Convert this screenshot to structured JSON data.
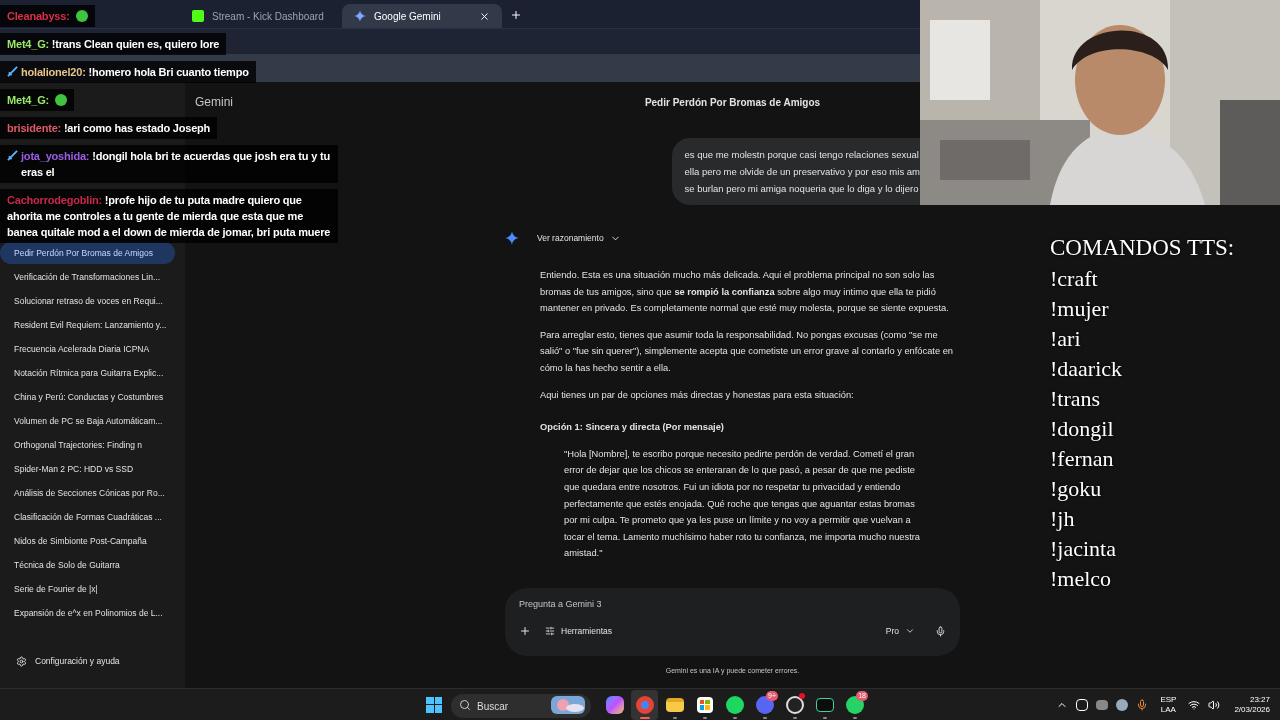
{
  "browser": {
    "tabs": [
      {
        "title": "Stream - Kick Dashboard",
        "selected": false
      },
      {
        "title": "Google Gemini",
        "selected": true
      }
    ]
  },
  "chat_overlay": {
    "messages": [
      {
        "user": "Cleanabyss:",
        "color": "#d9304a",
        "badge": false,
        "emote": true
      },
      {
        "user": "Met4_G:",
        "color": "#9be86a",
        "badge": false,
        "emote": false,
        "text": "!trans Clean quien es, quiero lore"
      },
      {
        "user": "holalionel20:",
        "color": "#e8c48a",
        "badge": true,
        "emote": false,
        "text": "!homero hola Bri cuanto tiempo"
      },
      {
        "user": "Met4_G:",
        "color": "#9be86a",
        "badge": false,
        "emote": true
      },
      {
        "user": "brisidente:",
        "color": "#e05a6a",
        "badge": false,
        "emote": false,
        "text": "!ari como has estado Joseph"
      },
      {
        "user": "jota_yoshida:",
        "color": "#9b5de5",
        "badge": true,
        "emote": false,
        "text": "!dongil hola bri te acuerdas que josh era tu y tu eras el"
      },
      {
        "user": "Cachorrodegoblin:",
        "color": "#c8284a",
        "badge": false,
        "emote": false,
        "text": "!profe hijo de tu puta madre quiero que ahorita me controles a tu gente de mierda que esta que me banea quitale mod a el down de mierda de jomar, bri puta muere"
      }
    ]
  },
  "gemini": {
    "product": "Gemini",
    "title": "Pedir Perdón Por Bromas de Amigos",
    "sidebar": {
      "items": [
        {
          "label": "Pedir Perdón Por Bromas de Amigos",
          "selected": true
        },
        {
          "label": "Verificación de Transformaciones Lin...",
          "selected": false
        },
        {
          "label": "Solucionar retraso de voces en Requi...",
          "selected": false
        },
        {
          "label": "Resident Evil Requiem: Lanzamiento y...",
          "selected": false
        },
        {
          "label": "Frecuencia Acelerada Diaria ICPNA",
          "selected": false
        },
        {
          "label": "Notación Rítmica para Guitarra Explic...",
          "selected": false
        },
        {
          "label": "China y Perú: Conductas y Costumbres",
          "selected": false
        },
        {
          "label": "Volumen de PC se Baja Automáticam...",
          "selected": false
        },
        {
          "label": "Orthogonal Trajectories: Finding n",
          "selected": false
        },
        {
          "label": "Spider-Man 2 PC: HDD vs SSD",
          "selected": false
        },
        {
          "label": "Análisis de Secciones Cónicas por Ro...",
          "selected": false
        },
        {
          "label": "Clasificación de Formas Cuadráticas ...",
          "selected": false
        },
        {
          "label": "Nidos de Simbionte Post-Campaña",
          "selected": false
        },
        {
          "label": "Técnica de Solo de Guitarra",
          "selected": false
        },
        {
          "label": "Serie de Fourier de |x|",
          "selected": false
        },
        {
          "label": "Expansión de e^x en Polinomios de L...",
          "selected": false
        }
      ],
      "footer": "Configuración y ayuda"
    },
    "user_message": [
      "es que me molestn porque casi tengo relaciones sexual",
      "ella pero me olvide de un preservativo y por eso mis am",
      "se burlan pero mi amiga noqueria que lo diga y lo dijero"
    ],
    "response": {
      "reasoning_label": "Ver razonamiento",
      "blocks": [
        {
          "kind": "paragraph",
          "text": "Entiendo. Esta es una situación mucho más delicada. Aqui el problema principal no son solo las bromas de tus amigos, sino que **se rompió la confianza** sobre algo muy intimo que ella te pidió mantener en privado. Es completamente normal que esté muy molesta, porque se siente expuesta."
        },
        {
          "kind": "paragraph",
          "text": "Para arreglar esto, tienes que asumir toda la responsabilidad. No pongas excusas (como \"se me salió\" o \"fue sin querer\"), simplemente acepta que cometiste un error grave al contarlo y enfócate en cómo la has hecho sentir a ella."
        },
        {
          "kind": "paragraph",
          "text": "Aqui tienes un par de opciones más directas y honestas para esta situación:"
        },
        {
          "kind": "heading",
          "text": "Opción 1: Sincera y directa (Por mensaje)"
        },
        {
          "kind": "quote",
          "text": "\"Hola [Nombre], te escribo porque necesito pedirte perdón de verdad. Cometí el gran error de dejar que los chicos se enteraran de lo que pasó, a pesar de que me pediste que quedara entre nosotros. Fui un idiota por no respetar tu privacidad y entiendo perfectamente que estés enojada. Qué roche que tengas que aguantar estas bromas por mi culpa. Te prometo que ya les puse un límite y no voy a permitir que vuelvan a tocar el tema. Lamento muchísimo haber roto tu confianza, me importa mucho nuestra amistad.\""
        }
      ]
    },
    "input": {
      "placeholder": "Pregunta a Gemini 3",
      "tools_label": "Herramientas",
      "model": "Pro"
    },
    "disclaimer": "Gemini es una IA y puede cometer errores."
  },
  "tts": {
    "title": "COMANDOS TTS:",
    "commands": [
      "!craft",
      "!mujer",
      "!ari",
      "!daarick",
      "!trans",
      "!dongil",
      "!fernan",
      "!goku",
      "!jh",
      "!jacinta",
      "!melco"
    ]
  },
  "taskbar": {
    "search_placeholder": "Buscar",
    "apps": [
      {
        "kind": "copilot",
        "active": false,
        "running": false,
        "alert": false
      },
      {
        "kind": "chrome",
        "active": true,
        "running": true,
        "alert": false
      },
      {
        "kind": "files",
        "active": false,
        "running": true,
        "alert": false
      },
      {
        "kind": "store",
        "active": false,
        "running": true,
        "alert": false
      },
      {
        "kind": "spotify",
        "active": false,
        "running": true,
        "alert": false
      },
      {
        "kind": "discord",
        "active": false,
        "running": true,
        "alert": false,
        "badge": "9+"
      },
      {
        "kind": "obs",
        "active": false,
        "running": true,
        "alert": true
      },
      {
        "kind": "terminal",
        "active": false,
        "running": true,
        "alert": false
      },
      {
        "kind": "whatsapp",
        "active": false,
        "running": true,
        "alert": false,
        "badge": "18"
      }
    ],
    "tray": {
      "language": "ESP",
      "layout": "LAA",
      "time": "23:27",
      "date": "2/03/2026"
    }
  }
}
